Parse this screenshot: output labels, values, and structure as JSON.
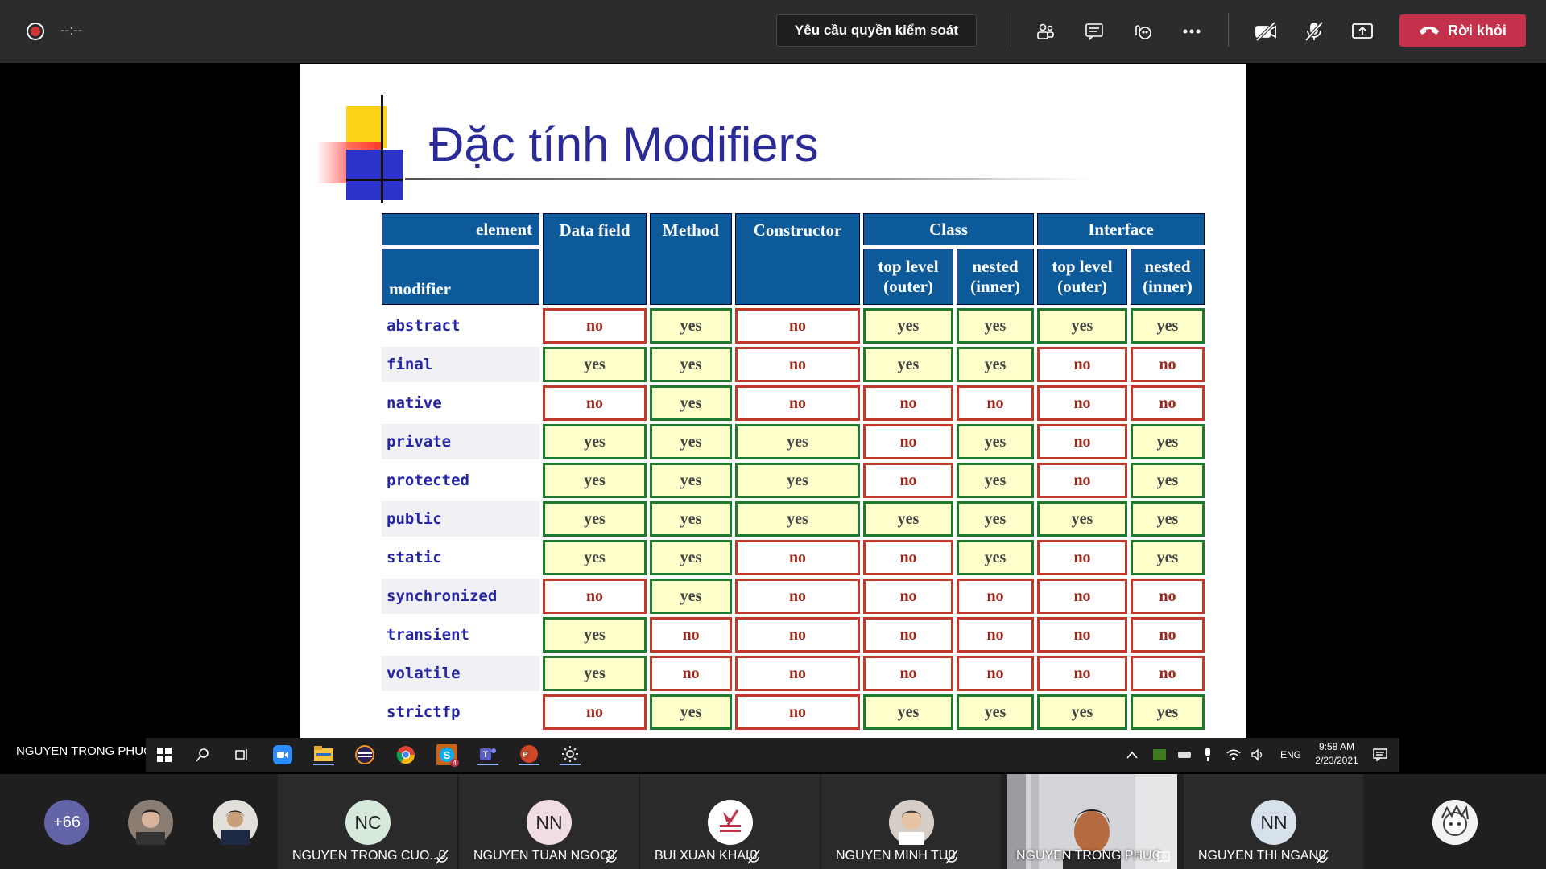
{
  "topbar": {
    "timer": "--:--",
    "request_control": "Yêu cầu quyền kiểm soát",
    "leave": "Rời khỏi"
  },
  "slide": {
    "title": "Đặc tính Modifiers",
    "header": {
      "element": "element",
      "modifier": "modifier",
      "data_field": "Data field",
      "method": "Method",
      "constructor": "Constructor",
      "class": "Class",
      "interface": "Interface",
      "top_level_1": "top level",
      "top_level_2": "(outer)",
      "nested_1": "nested",
      "nested_2": "(inner)"
    },
    "rows": [
      {
        "modifier": "abstract",
        "values": [
          "no",
          "yes",
          "no",
          "yes",
          "yes",
          "yes",
          "yes"
        ]
      },
      {
        "modifier": "final",
        "values": [
          "yes",
          "yes",
          "no",
          "yes",
          "yes",
          "no",
          "no"
        ]
      },
      {
        "modifier": "native",
        "values": [
          "no",
          "yes",
          "no",
          "no",
          "no",
          "no",
          "no"
        ]
      },
      {
        "modifier": "private",
        "values": [
          "yes",
          "yes",
          "yes",
          "no",
          "yes",
          "no",
          "yes"
        ]
      },
      {
        "modifier": "protected",
        "values": [
          "yes",
          "yes",
          "yes",
          "no",
          "yes",
          "no",
          "yes"
        ]
      },
      {
        "modifier": "public",
        "values": [
          "yes",
          "yes",
          "yes",
          "yes",
          "yes",
          "yes",
          "yes"
        ]
      },
      {
        "modifier": "static",
        "values": [
          "yes",
          "yes",
          "no",
          "no",
          "yes",
          "no",
          "yes"
        ]
      },
      {
        "modifier": "synchronized",
        "values": [
          "no",
          "yes",
          "no",
          "no",
          "no",
          "no",
          "no"
        ]
      },
      {
        "modifier": "transient",
        "values": [
          "yes",
          "no",
          "no",
          "no",
          "no",
          "no",
          "no"
        ]
      },
      {
        "modifier": "volatile",
        "values": [
          "yes",
          "no",
          "no",
          "no",
          "no",
          "no",
          "no"
        ]
      },
      {
        "modifier": "strictfp",
        "values": [
          "no",
          "yes",
          "no",
          "yes",
          "yes",
          "yes",
          "yes"
        ]
      }
    ]
  },
  "presenter": "NGUYEN TRONG PHUC",
  "tray": {
    "lang": "ENG",
    "time": "9:58 AM",
    "date": "2/23/2021",
    "skype_badge": "4"
  },
  "participants": {
    "more_count": "+66",
    "tiles": [
      {
        "initials": "NC",
        "name": "NGUYEN TRONG CUO...",
        "color": "#d6e9da"
      },
      {
        "initials": "NN",
        "name": "NGUYEN TUAN NGOC",
        "color": "#f0dce4"
      },
      {
        "initials": "",
        "name": "BUI XUAN KHAI",
        "color": "#ffffff"
      },
      {
        "initials": "",
        "name": "NGUYEN MINH TU",
        "color": "#d9d4cf"
      },
      {
        "initials": "",
        "name": "NGUYEN TRONG PHUC",
        "color": "#8a8a8a"
      },
      {
        "initials": "NN",
        "name": "NGUYEN THI NGAN",
        "color": "#d7e1ec"
      }
    ]
  }
}
